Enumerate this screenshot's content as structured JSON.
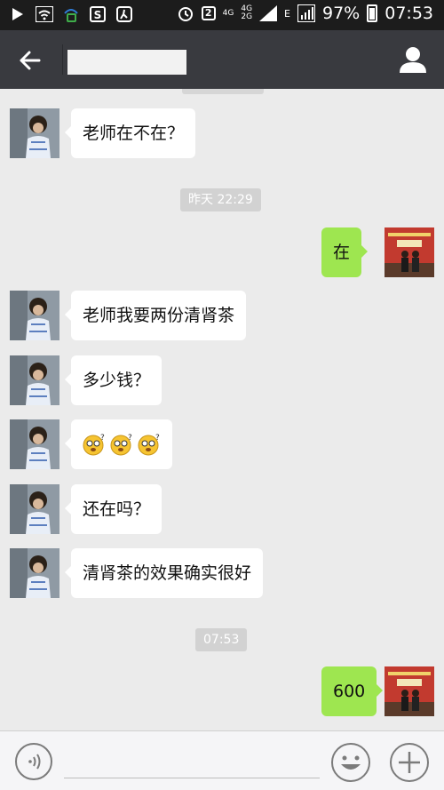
{
  "status_bar": {
    "sim": "2",
    "net_top": "4G",
    "net_mid": "4G",
    "net_bottom": "2G",
    "data_type": "E",
    "battery": "97%",
    "time": "07:53"
  },
  "header": {
    "back_icon": "arrow-left-icon",
    "title": "",
    "profile_icon": "person-icon"
  },
  "messages": [
    {
      "side": "in",
      "text": "老师在不在？"
    },
    {
      "timestamp": "昨天 22:29"
    },
    {
      "side": "out",
      "text": "在"
    },
    {
      "side": "in",
      "text": "老师我要两份清肾茶"
    },
    {
      "side": "in",
      "text": "多少钱？"
    },
    {
      "side": "in",
      "emoji_count": 3
    },
    {
      "side": "in",
      "text": "还在吗？"
    },
    {
      "side": "in",
      "text": "清肾茶的效果确实很好"
    },
    {
      "timestamp": "07:53"
    },
    {
      "side": "out",
      "text": "600"
    }
  ],
  "input_bar": {
    "voice_icon": "voice-icon",
    "emoji_icon": "emoji-icon",
    "plus_icon": "plus-icon"
  },
  "colors": {
    "header_bg": "#393a3f",
    "chat_bg": "#ebebeb",
    "outgoing_bubble": "#9ee650",
    "incoming_bubble": "#ffffff"
  }
}
